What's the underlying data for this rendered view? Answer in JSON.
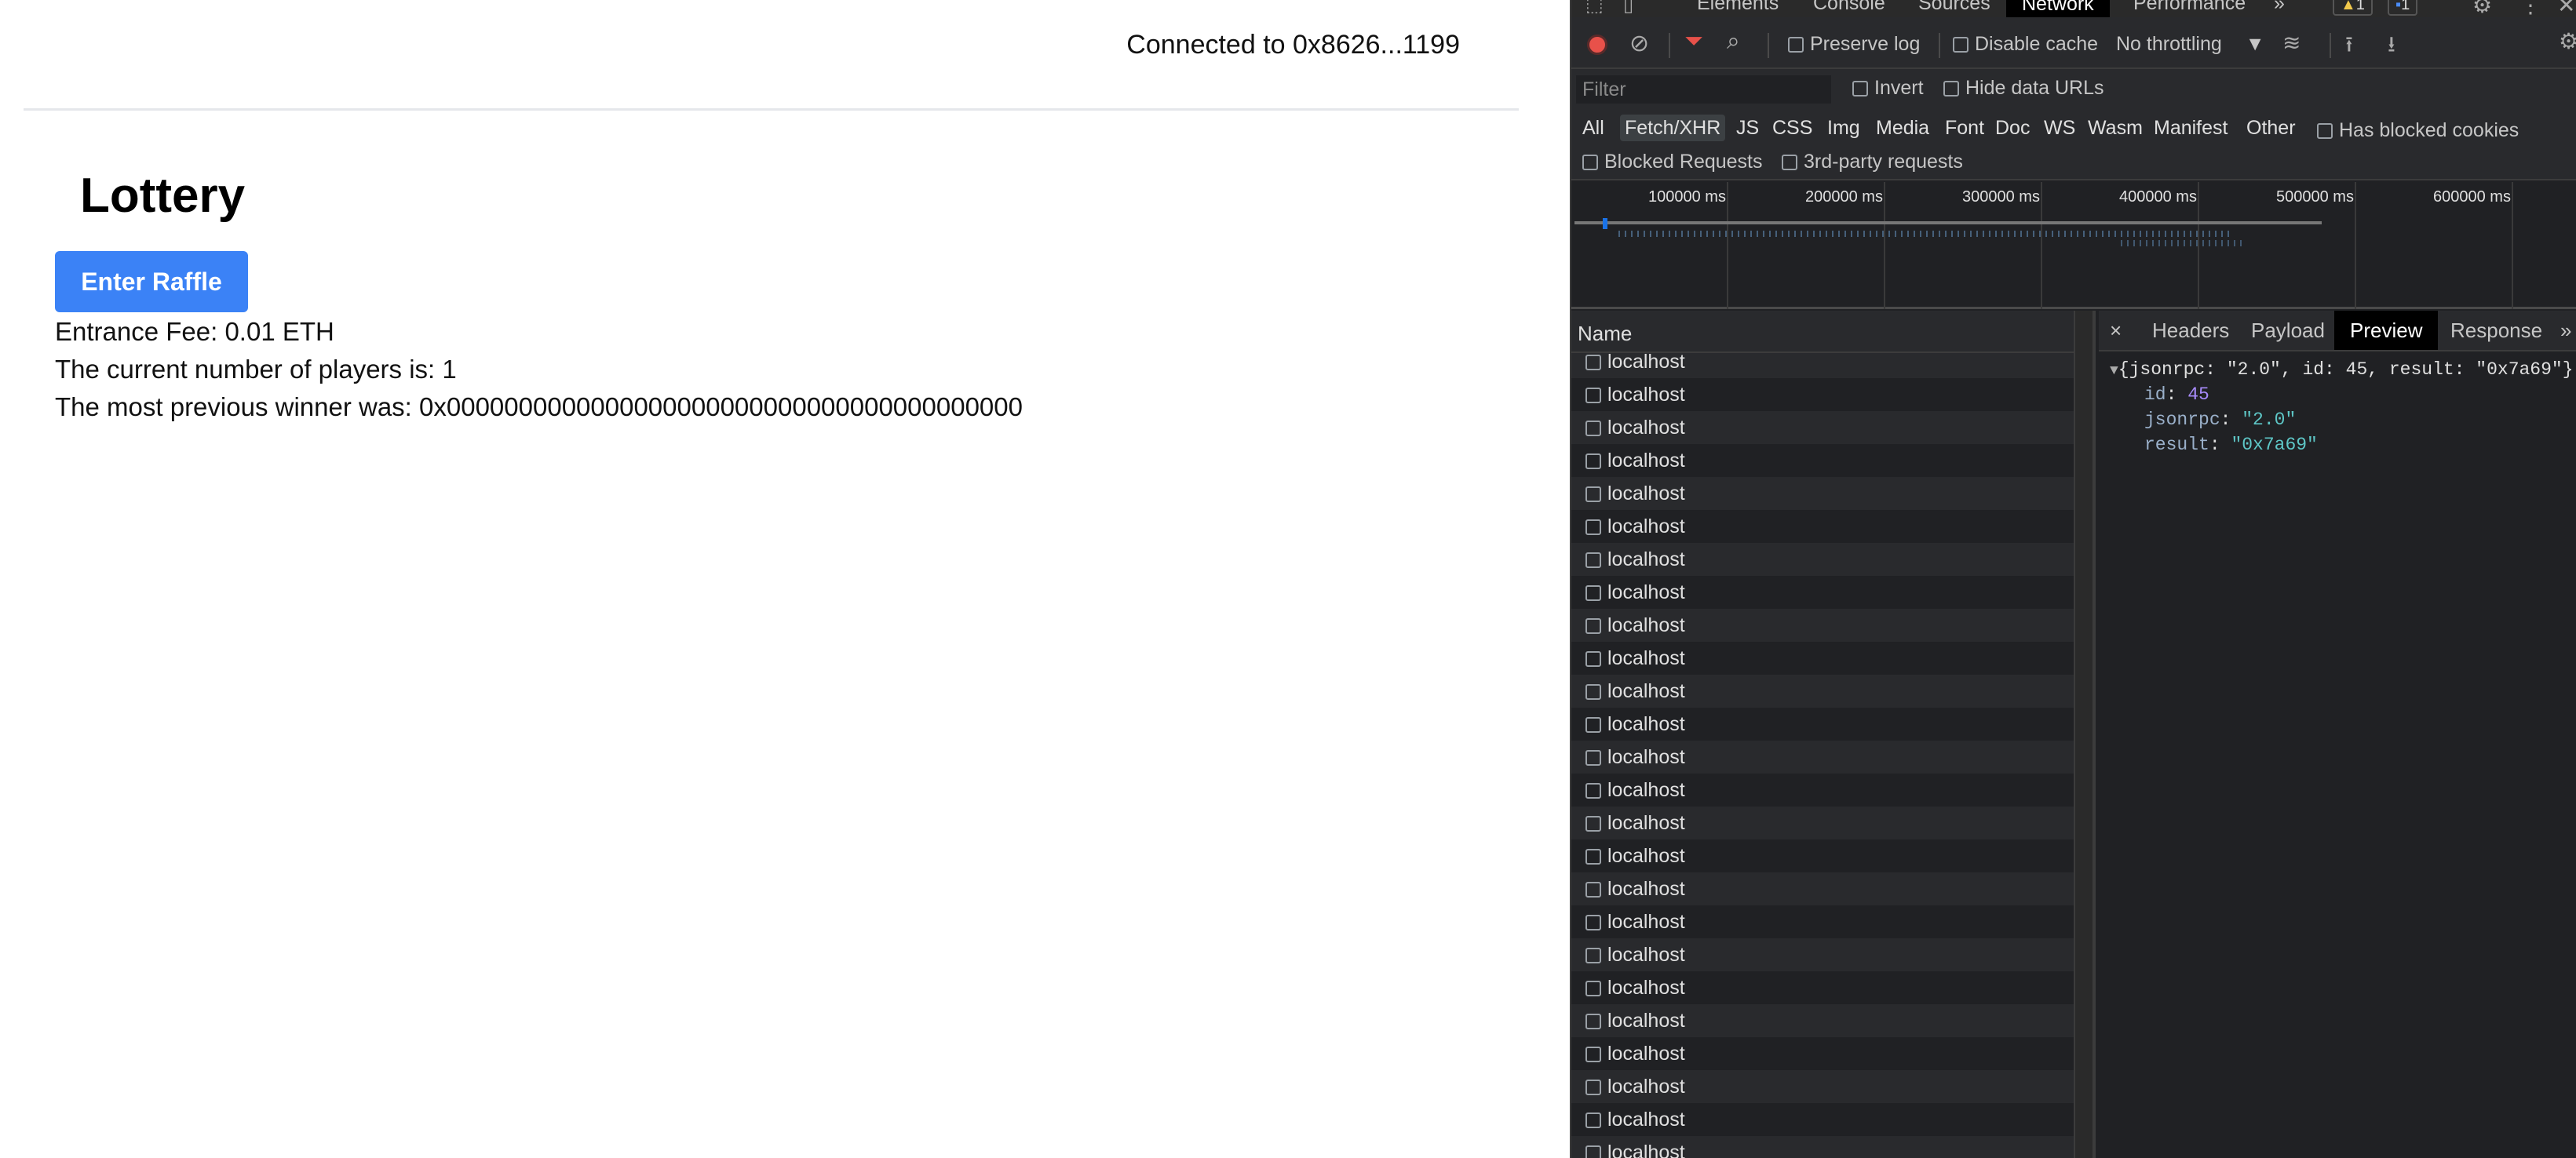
{
  "app": {
    "connected": "Connected to 0x8626...1199",
    "title": "Lottery",
    "enter_button": "Enter Raffle",
    "entrance_fee": "Entrance Fee: 0.01 ETH",
    "players": "The current number of players is: 1",
    "winner": "The most previous winner was: 0x0000000000000000000000000000000000000000",
    "accent_color": "#3b82f6"
  },
  "devtools": {
    "tabs": [
      "Elements",
      "Console",
      "Sources",
      "Network",
      "Performance"
    ],
    "more_tabs": "»",
    "warnings_count": "1",
    "messages_count": "1",
    "toolbar": {
      "preserve_log": "Preserve log",
      "disable_cache": "Disable cache",
      "throttling": "No throttling"
    },
    "filter": {
      "placeholder": "Filter",
      "invert": "Invert",
      "hide_data_urls": "Hide data URLs"
    },
    "types": [
      "All",
      "Fetch/XHR",
      "JS",
      "CSS",
      "Img",
      "Media",
      "Font",
      "Doc",
      "WS",
      "Wasm",
      "Manifest",
      "Other"
    ],
    "has_blocked_cookies": "Has blocked cookies",
    "blocked_requests": "Blocked Requests",
    "third_party": "3rd-party requests",
    "timeline_labels": [
      "100000 ms",
      "200000 ms",
      "300000 ms",
      "400000 ms",
      "500000 ms",
      "600000 ms"
    ],
    "name_header": "Name",
    "request_name": "localhost",
    "request_count": 25,
    "detail_tabs": [
      "Headers",
      "Payload",
      "Preview",
      "Response"
    ],
    "close_symbol": "×",
    "preview": {
      "summary": "{jsonrpc: \"2.0\", id: 45, result: \"0x7a69\"}",
      "id_key": "id",
      "id_val": "45",
      "jsonrpc_key": "jsonrpc",
      "jsonrpc_val": "\"2.0\"",
      "result_key": "result",
      "result_val": "\"0x7a69\""
    }
  }
}
